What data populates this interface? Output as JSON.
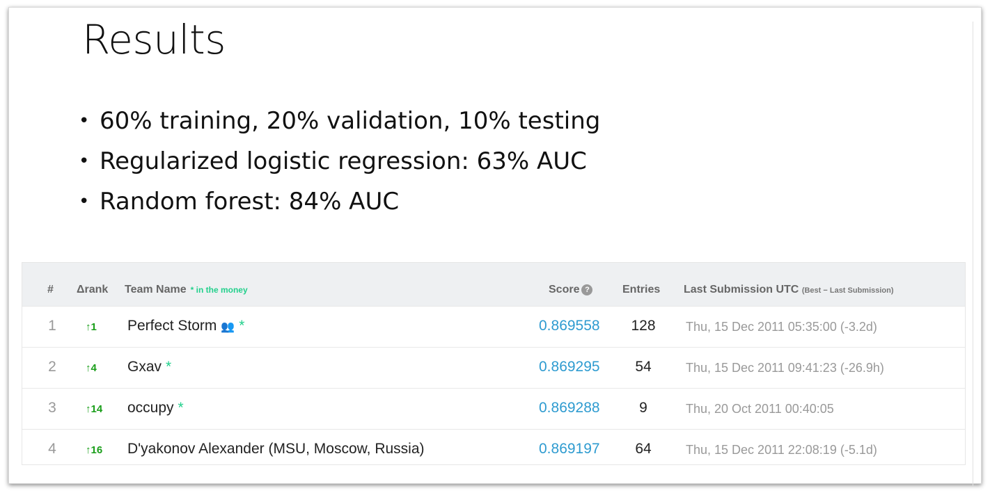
{
  "slide": {
    "title": "Results",
    "bullets": [
      "60% training, 20% validation, 10% testing",
      "Regularized logistic regression: 63% AUC",
      "Random forest: 84% AUC"
    ]
  },
  "leaderboard": {
    "headers": {
      "rank": "#",
      "delta": "Δrank",
      "team": "Team Name",
      "money_note": "* in the money",
      "score": "Score",
      "entries": "Entries",
      "last": "Last Submission UTC",
      "last_sub": "(Best − Last Submission)"
    },
    "rows": [
      {
        "rank": "1",
        "delta": "↑1",
        "team": "Perfect Storm",
        "score": "0.869558",
        "entries": "128",
        "date": "Thu, 15 Dec 2011 05:35:00 (-3.2d)"
      },
      {
        "rank": "2",
        "delta": "↑4",
        "team": "Gxav",
        "score": "0.869295",
        "entries": "54",
        "date": "Thu, 15 Dec 2011 09:41:23 (-26.9h)"
      },
      {
        "rank": "3",
        "delta": "↑14",
        "team": "occupy",
        "score": "0.869288",
        "entries": "9",
        "date": "Thu, 20 Oct 2011 00:40:05"
      },
      {
        "rank": "4",
        "delta": "↑16",
        "team": "D'yakonov Alexander (MSU, Moscow, Russia)",
        "score": "0.869197",
        "entries": "64",
        "date": "Thu, 15 Dec 2011 22:08:19 (-5.1d)"
      }
    ]
  },
  "colors": {
    "score_link": "#2e9bd0",
    "delta_up": "#1a9e1a",
    "in_the_money": "#22d08c",
    "header_bg": "#eef0f2"
  }
}
